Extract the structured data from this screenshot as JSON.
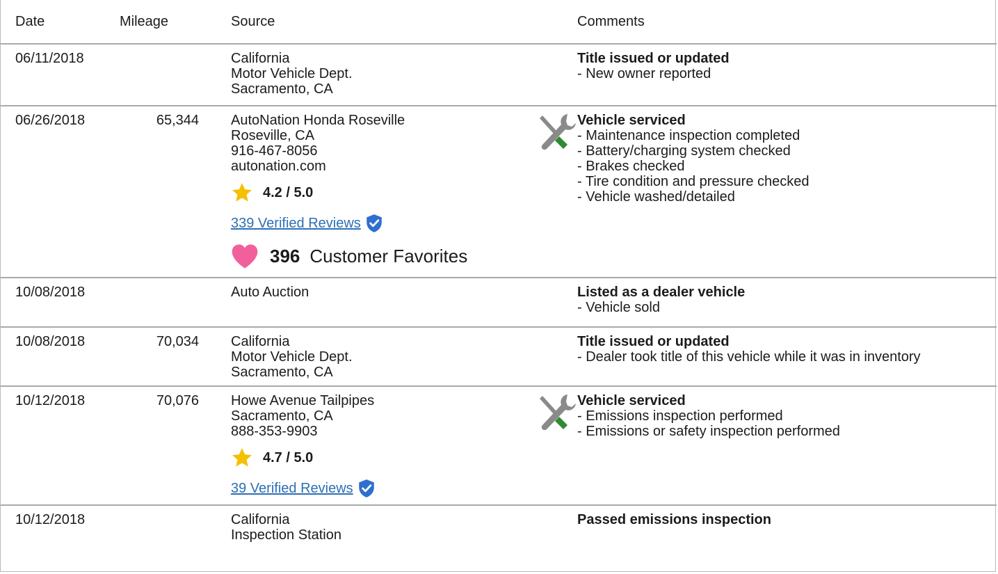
{
  "headers": {
    "date": "Date",
    "mileage": "Mileage",
    "source": "Source",
    "comments": "Comments"
  },
  "rows": [
    {
      "date": "06/11/2018",
      "mileage": "",
      "source_lines": [
        "California",
        "Motor Vehicle Dept.",
        "Sacramento, CA"
      ],
      "comment_title": "Title issued or updated",
      "comment_items": [
        "- New owner reported"
      ]
    },
    {
      "date": "06/26/2018",
      "mileage": "65,344",
      "source_lines": [
        "AutoNation Honda Roseville",
        "Roseville, CA",
        "916-467-8056",
        "autonation.com"
      ],
      "rating": "4.2 / 5.0",
      "reviews_link": "339 Verified Reviews",
      "favorites_count": "396",
      "favorites_label": "Customer Favorites",
      "comment_icon": "service-wrench-screwdriver-icon",
      "comment_title": "Vehicle serviced",
      "comment_items": [
        "- Maintenance inspection completed",
        "- Battery/charging system checked",
        "- Brakes checked",
        "- Tire condition and pressure checked",
        "- Vehicle washed/detailed"
      ]
    },
    {
      "date": "10/08/2018",
      "mileage": "",
      "source_lines": [
        "Auto Auction"
      ],
      "comment_title": "Listed as a dealer vehicle",
      "comment_items": [
        "- Vehicle sold"
      ]
    },
    {
      "date": "10/08/2018",
      "mileage": "70,034",
      "source_lines": [
        "California",
        "Motor Vehicle Dept.",
        "Sacramento, CA"
      ],
      "comment_title": "Title issued or updated",
      "comment_items": [
        "- Dealer took title of this vehicle while it was in inventory"
      ]
    },
    {
      "date": "10/12/2018",
      "mileage": "70,076",
      "source_lines": [
        "Howe Avenue Tailpipes",
        "Sacramento, CA",
        "888-353-9903"
      ],
      "rating": "4.7 / 5.0",
      "reviews_link": "39 Verified Reviews",
      "comment_icon": "service-wrench-screwdriver-icon",
      "comment_title": "Vehicle serviced",
      "comment_items": [
        "- Emissions inspection performed",
        "- Emissions or safety inspection performed"
      ]
    },
    {
      "date": "10/12/2018",
      "mileage": "",
      "source_lines": [
        "California",
        "Inspection Station"
      ],
      "comment_title": "Passed emissions inspection",
      "comment_items": []
    }
  ],
  "colors": {
    "link": "#2c6fb5",
    "star": "#f5c000",
    "heart": "#f2609c",
    "shield": "#2f6fcf",
    "screwdriver_handle": "#2e8b34",
    "tool_gray": "#8a8a8a",
    "border": "#a9a9a9"
  }
}
